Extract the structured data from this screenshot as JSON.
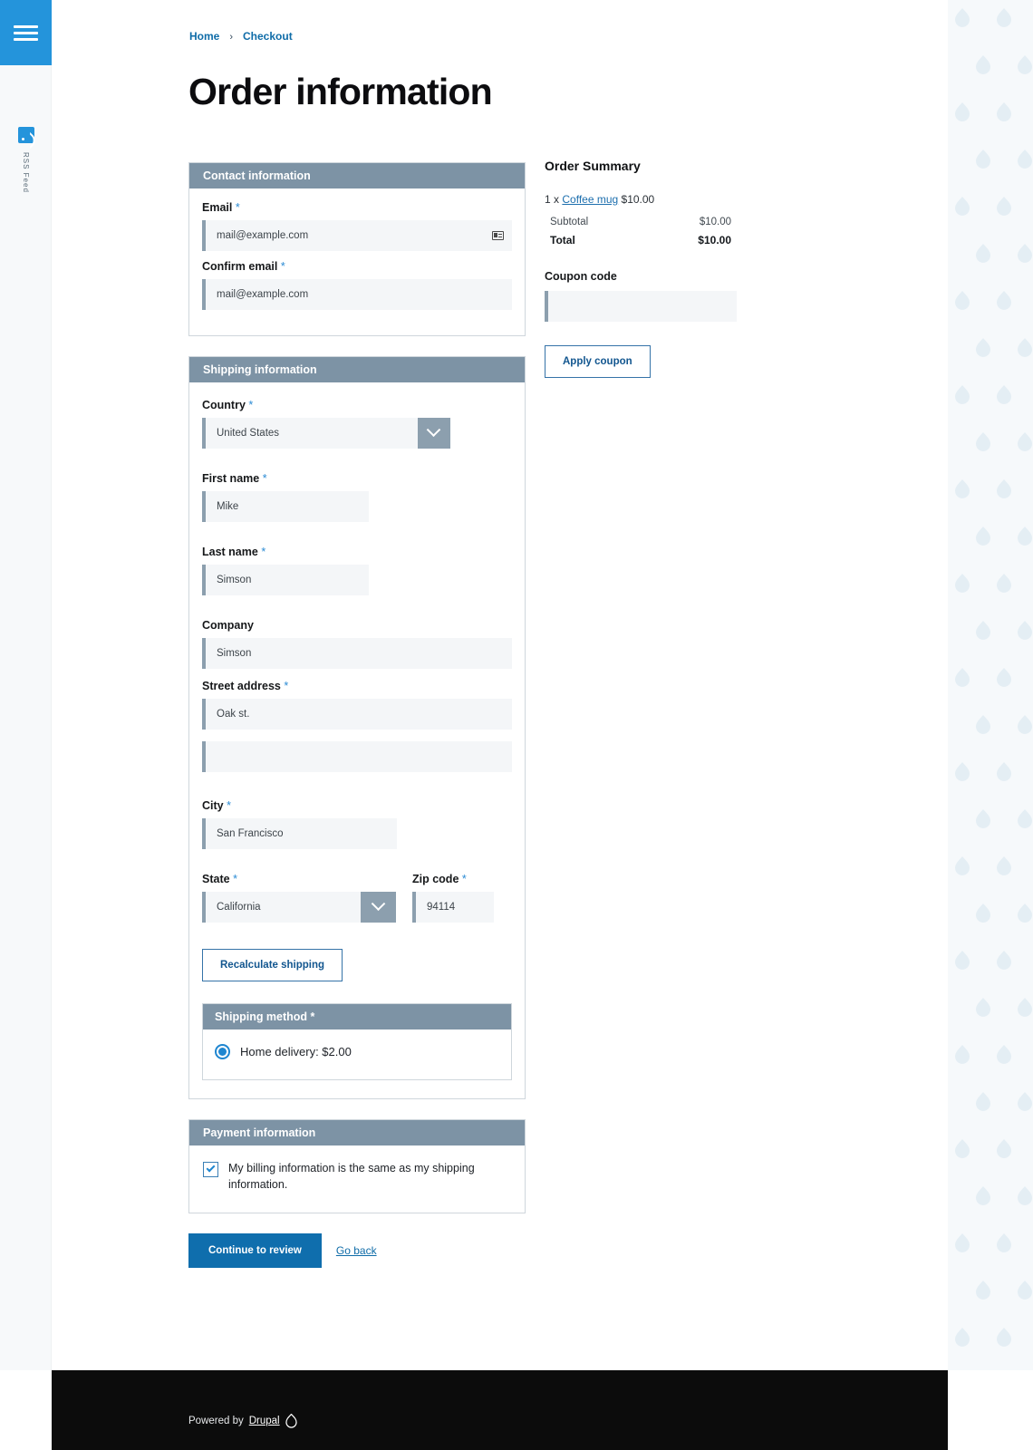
{
  "sidebar": {
    "menu_icon": "hamburger-menu-icon",
    "rss": {
      "icon": "rss-feed-icon",
      "label": "RSS Feed"
    }
  },
  "breadcrumb": {
    "home": "Home",
    "separator": "›",
    "current": "Checkout"
  },
  "page_title": "Order information",
  "contact": {
    "heading": "Contact information",
    "email": {
      "label": "Email",
      "required": "*",
      "value": "mail@example.com",
      "icon": "contact-card-autofill-icon"
    },
    "confirm_email": {
      "label": "Confirm email",
      "required": "*",
      "value": "mail@example.com"
    }
  },
  "shipping": {
    "heading": "Shipping information",
    "country": {
      "label": "Country",
      "required": "*",
      "value": "United States"
    },
    "first_name": {
      "label": "First name",
      "required": "*",
      "value": "Mike"
    },
    "last_name": {
      "label": "Last name",
      "required": "*",
      "value": "Simson"
    },
    "company": {
      "label": "Company",
      "required": "",
      "value": "Simson"
    },
    "street": {
      "label": "Street address",
      "required": "*",
      "value": "Oak st.",
      "line2": ""
    },
    "city": {
      "label": "City",
      "required": "*",
      "value": "San Francisco"
    },
    "state": {
      "label": "State",
      "required": "*",
      "value": "California"
    },
    "zip": {
      "label": "Zip code",
      "required": "*",
      "value": "94114"
    },
    "recalculate_button": "Recalculate shipping",
    "method": {
      "heading": "Shipping method *",
      "options": [
        {
          "label": "Home delivery: $2.00",
          "selected": true
        }
      ]
    }
  },
  "payment": {
    "heading": "Payment information",
    "billing_same_label": "My billing information is the same as my shipping information.",
    "billing_same_checked": true
  },
  "actions": {
    "continue_label": "Continue to review",
    "go_back_label": "Go back"
  },
  "order_summary": {
    "title": "Order Summary",
    "item_prefix": "1 x",
    "item_name": "Coffee mug",
    "item_price": "$10.00",
    "rows": [
      {
        "label": "Subtotal",
        "value": "$10.00"
      },
      {
        "label": "Total",
        "value": "$10.00"
      }
    ],
    "coupon_label": "Coupon code",
    "coupon_value": "",
    "apply_button": "Apply coupon"
  },
  "footer": {
    "powered_by": "Powered by",
    "brand": "Drupal",
    "logo": "drupal-droplet-icon"
  },
  "colors": {
    "accent_blue": "#2494db",
    "primary_button": "#0f6ead",
    "link_blue": "#0f6ca8",
    "panel_header": "#7d93a5",
    "input_bg": "#f4f6f8",
    "input_accent": "#8c9fae",
    "footer_bg": "#0c0c0c"
  }
}
